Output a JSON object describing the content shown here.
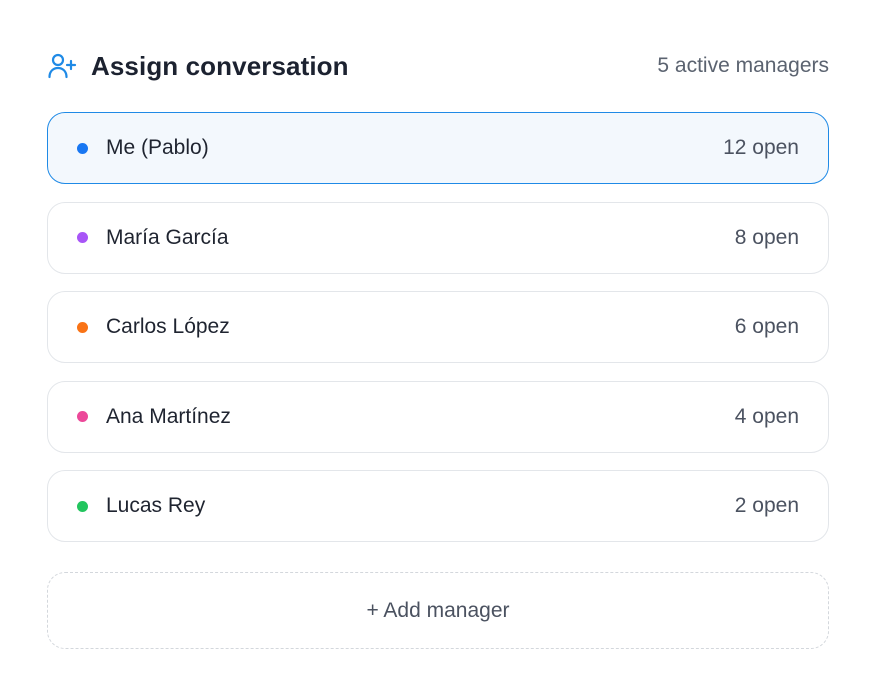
{
  "header": {
    "icon": "user-plus-icon",
    "title": "Assign conversation",
    "count": "5 active managers",
    "accent": "#1f8ae6"
  },
  "managers": [
    {
      "name": "Me (Pablo)",
      "open": "12 open",
      "color": "#1877f2",
      "selected": true
    },
    {
      "name": "María García",
      "open": "8 open",
      "color": "#a855f7",
      "selected": false
    },
    {
      "name": "Carlos López",
      "open": "6 open",
      "color": "#f97316",
      "selected": false
    },
    {
      "name": "Ana Martínez",
      "open": "4 open",
      "color": "#ec4899",
      "selected": false
    },
    {
      "name": "Lucas Rey",
      "open": "2 open",
      "color": "#22c55e",
      "selected": false
    }
  ],
  "add_button": {
    "label": "+ Add manager"
  }
}
